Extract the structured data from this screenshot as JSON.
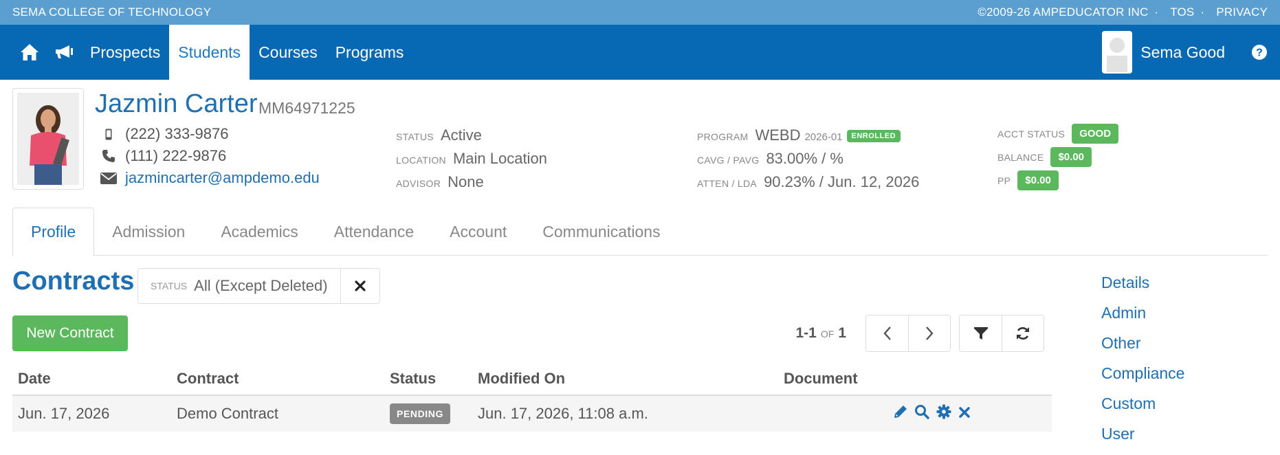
{
  "topbar": {
    "org_name": "SEMA COLLEGE OF TECHNOLOGY",
    "copyright": "©2009-26 AMPEDUCATOR INC",
    "tos": "TOS",
    "privacy": "PRIVACY",
    "dot": "·"
  },
  "nav": {
    "items": [
      {
        "label": "Prospects"
      },
      {
        "label": "Students"
      },
      {
        "label": "Courses"
      },
      {
        "label": "Programs"
      }
    ],
    "active": "Students",
    "user_name": "Sema Good"
  },
  "student": {
    "name": "Jazmin Carter",
    "id": "MM64971225",
    "mobile": "(222) 333-9876",
    "phone": "(111) 222-9876",
    "email": "jazmincarter@ampdemo.edu"
  },
  "info": {
    "status_label": "STATUS",
    "status": "Active",
    "location_label": "LOCATION",
    "location": "Main Location",
    "advisor_label": "ADVISOR",
    "advisor": "None",
    "program_label": "PROGRAM",
    "program": "WEBD",
    "program_term": "2026-01",
    "program_badge": "ENROLLED",
    "cavg_label": "CAVG / PAVG",
    "cavg": "83.00% / %",
    "atten_label": "ATTEN / LDA",
    "atten": "90.23% / Jun. 12, 2026",
    "acct_label": "ACCT STATUS",
    "acct": "GOOD",
    "balance_label": "BALANCE",
    "balance": "$0.00",
    "pp_label": "PP",
    "pp": "$0.00"
  },
  "tabs": [
    "Profile",
    "Admission",
    "Academics",
    "Attendance",
    "Account",
    "Communications"
  ],
  "contracts": {
    "title": "Contracts",
    "filter_label": "STATUS",
    "filter_value": "All (Except Deleted)",
    "new_button": "New Contract",
    "range": "1-1",
    "of": "OF",
    "total": "1",
    "columns": [
      "Date",
      "Contract",
      "Status",
      "Modified On",
      "Document"
    ],
    "rows": [
      {
        "date": "Jun. 17, 2026",
        "contract": "Demo Contract",
        "status": "PENDING",
        "modified": "Jun. 17, 2026, 11:08 a.m.",
        "document": ""
      }
    ]
  },
  "side_links": [
    "Details",
    "Admin",
    "Other",
    "Compliance",
    "Custom",
    "User"
  ],
  "colors": {
    "top_strip": "#5b9fd1",
    "nav": "#0769b4",
    "link": "#1f6fb3",
    "success": "#5cb85c",
    "pending": "#888888"
  }
}
